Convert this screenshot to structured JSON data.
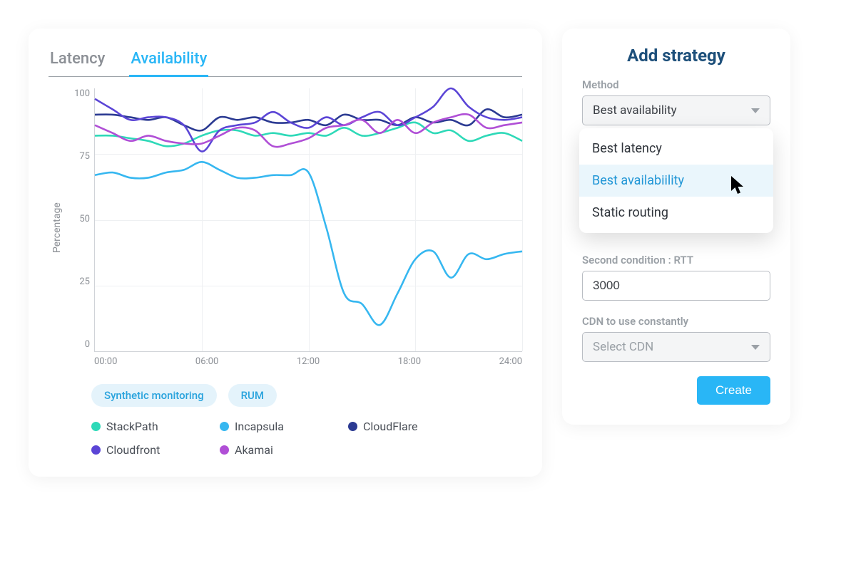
{
  "tabs": {
    "latency": "Latency",
    "availability": "Availability",
    "active": "availability"
  },
  "sidepanel": {
    "title": "Add strategy",
    "method_label": "Method",
    "method_value": "Best availability",
    "method_options": [
      "Best latency",
      "Best availabiility",
      "Static routing"
    ],
    "hovered_option_index": 1,
    "second_condition_label": "Second condition : RTT",
    "second_condition_value": "3000",
    "cdn_label": "CDN to use constantly",
    "cdn_placeholder": "Select CDN",
    "create_label": "Create"
  },
  "pills": {
    "a": "Synthetic monitoring",
    "b": "RUM"
  },
  "chart_data": {
    "type": "line",
    "title": "",
    "xlabel": "",
    "ylabel": "Percentage",
    "ylim": [
      0,
      100
    ],
    "x_ticks": [
      "00:00",
      "06:00",
      "12:00",
      "18:00",
      "24:00"
    ],
    "y_ticks": [
      100,
      75,
      50,
      25,
      0
    ],
    "categories": [
      "00:00",
      "01:00",
      "02:00",
      "03:00",
      "04:00",
      "05:00",
      "06:00",
      "07:00",
      "08:00",
      "09:00",
      "10:00",
      "11:00",
      "12:00",
      "13:00",
      "14:00",
      "15:00",
      "16:00",
      "17:00",
      "18:00",
      "19:00",
      "20:00",
      "21:00",
      "22:00",
      "23:00",
      "24:00"
    ],
    "series": [
      {
        "name": "StackPath",
        "color": "#2ed9b8",
        "values": [
          82,
          82,
          81,
          80,
          78,
          79,
          82,
          84,
          84,
          82,
          83,
          82,
          83,
          82,
          85,
          82,
          83,
          85,
          87,
          83,
          84,
          80,
          82,
          83,
          80
        ]
      },
      {
        "name": "Incapsula",
        "color": "#36b7f0",
        "values": [
          67,
          68,
          66,
          66,
          68,
          69,
          72,
          69,
          66,
          66,
          67,
          67,
          68,
          47,
          22,
          18,
          10,
          22,
          35,
          38,
          28,
          37,
          35,
          37,
          38
        ]
      },
      {
        "name": "CloudFlare",
        "color": "#2b3a92",
        "values": [
          90,
          90,
          89,
          88,
          89,
          86,
          84,
          89,
          88,
          89,
          87,
          87,
          88,
          86,
          90,
          88,
          88,
          86,
          89,
          87,
          88,
          86,
          92,
          89,
          90
        ]
      },
      {
        "name": "Cloudfront",
        "color": "#5b45d6",
        "values": [
          96,
          92,
          88,
          89,
          89,
          86,
          76,
          84,
          86,
          87,
          91,
          87,
          85,
          89,
          86,
          89,
          91,
          86,
          89,
          93,
          100,
          93,
          89,
          88,
          89
        ]
      },
      {
        "name": "Akamai",
        "color": "#b04fd6",
        "values": [
          86,
          83,
          80,
          82,
          80,
          79,
          79,
          82,
          85,
          84,
          78,
          79,
          81,
          85,
          86,
          88,
          83,
          88,
          83,
          87,
          89,
          90,
          85,
          86,
          87
        ]
      }
    ]
  }
}
